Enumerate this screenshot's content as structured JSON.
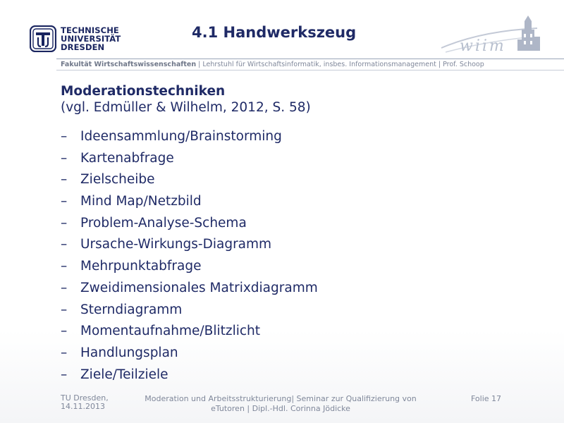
{
  "header": {
    "logo": {
      "line1": "TECHNISCHE",
      "line2": "UNIVERSITÄT",
      "line3": "DRESDEN"
    },
    "title": "4.1 Handwerkszeug",
    "faculty": "Fakultät Wirtschaftswissenschaften",
    "chair": " | Lehrstuhl für Wirtschaftsinformatik, insbes. Informationsmanagement | Prof. Schoop",
    "corner_logo_text": "wiim"
  },
  "content": {
    "heading": "Moderationstechniken",
    "subheading": "(vgl. Edmüller & Wilhelm, 2012, S. 58)",
    "bullet_marker": "–",
    "items": [
      "Ideensammlung/Brainstorming",
      "Kartenabfrage",
      "Zielscheibe",
      "Mind Map/Netzbild",
      "Problem-Analyse-Schema",
      "Ursache-Wirkungs-Diagramm",
      "Mehrpunktabfrage",
      "Zweidimensionales Matrixdiagramm",
      "Sterndiagramm",
      "Momentaufnahme/Blitzlicht",
      "Handlungsplan",
      "Ziele/Teilziele"
    ]
  },
  "footer": {
    "place": "TU Dresden,",
    "date": "14.11.2013",
    "center_line1": "Moderation und Arbeitsstrukturierung| Seminar zur Qualifizierung von",
    "center_line2": "eTutoren | Dipl.-Hdl. Corinna Jödicke",
    "slide_number": "Folie 17"
  },
  "colors": {
    "primary": "#1f2a66",
    "muted": "#7f879a",
    "rule": "#9aa4b8"
  }
}
